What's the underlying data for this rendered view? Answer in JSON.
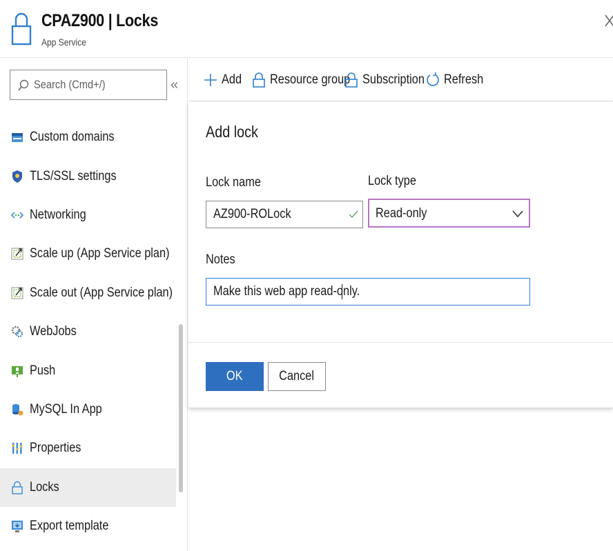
{
  "header": {
    "title": "CPAZ900 | Locks",
    "subtitle": "App Service",
    "icon": "lock-icon",
    "close_icon": "close-icon"
  },
  "search": {
    "placeholder": "Search (Cmd+/)",
    "collapse_label": "«"
  },
  "sidebar": {
    "items": [
      {
        "label": "Custom domains",
        "icon": "custom-domains-icon",
        "active": false
      },
      {
        "label": "TLS/SSL settings",
        "icon": "shield-icon",
        "active": false
      },
      {
        "label": "Networking",
        "icon": "networking-icon",
        "active": false
      },
      {
        "label": "Scale up (App Service plan)",
        "icon": "scale-up-icon",
        "active": false
      },
      {
        "label": "Scale out (App Service plan)",
        "icon": "scale-out-icon",
        "active": false
      },
      {
        "label": "WebJobs",
        "icon": "webjobs-icon",
        "active": false
      },
      {
        "label": "Push",
        "icon": "push-icon",
        "active": false
      },
      {
        "label": "MySQL In App",
        "icon": "mysql-icon",
        "active": false
      },
      {
        "label": "Properties",
        "icon": "properties-icon",
        "active": false
      },
      {
        "label": "Locks",
        "icon": "lock-icon",
        "active": true
      },
      {
        "label": "Export template",
        "icon": "export-template-icon",
        "active": false
      }
    ]
  },
  "toolbar": {
    "add_label": "Add",
    "resource_group_label": "Resource group",
    "subscription_label": "Subscription",
    "refresh_label": "Refresh"
  },
  "panel": {
    "title": "Add lock",
    "lock_name_label": "Lock name",
    "lock_name_value": "AZ900-ROLock",
    "lock_type_label": "Lock type",
    "lock_type_value": "Read-only",
    "notes_label": "Notes",
    "notes_value": "Make this web app read-only.",
    "ok_label": "OK",
    "cancel_label": "Cancel"
  },
  "colors": {
    "accent": "#2f6fc0",
    "select_border": "#b573c2",
    "notes_border": "#2f7fcf",
    "valid_check": "#5aa85a",
    "active_item_bg": "#ececec"
  }
}
